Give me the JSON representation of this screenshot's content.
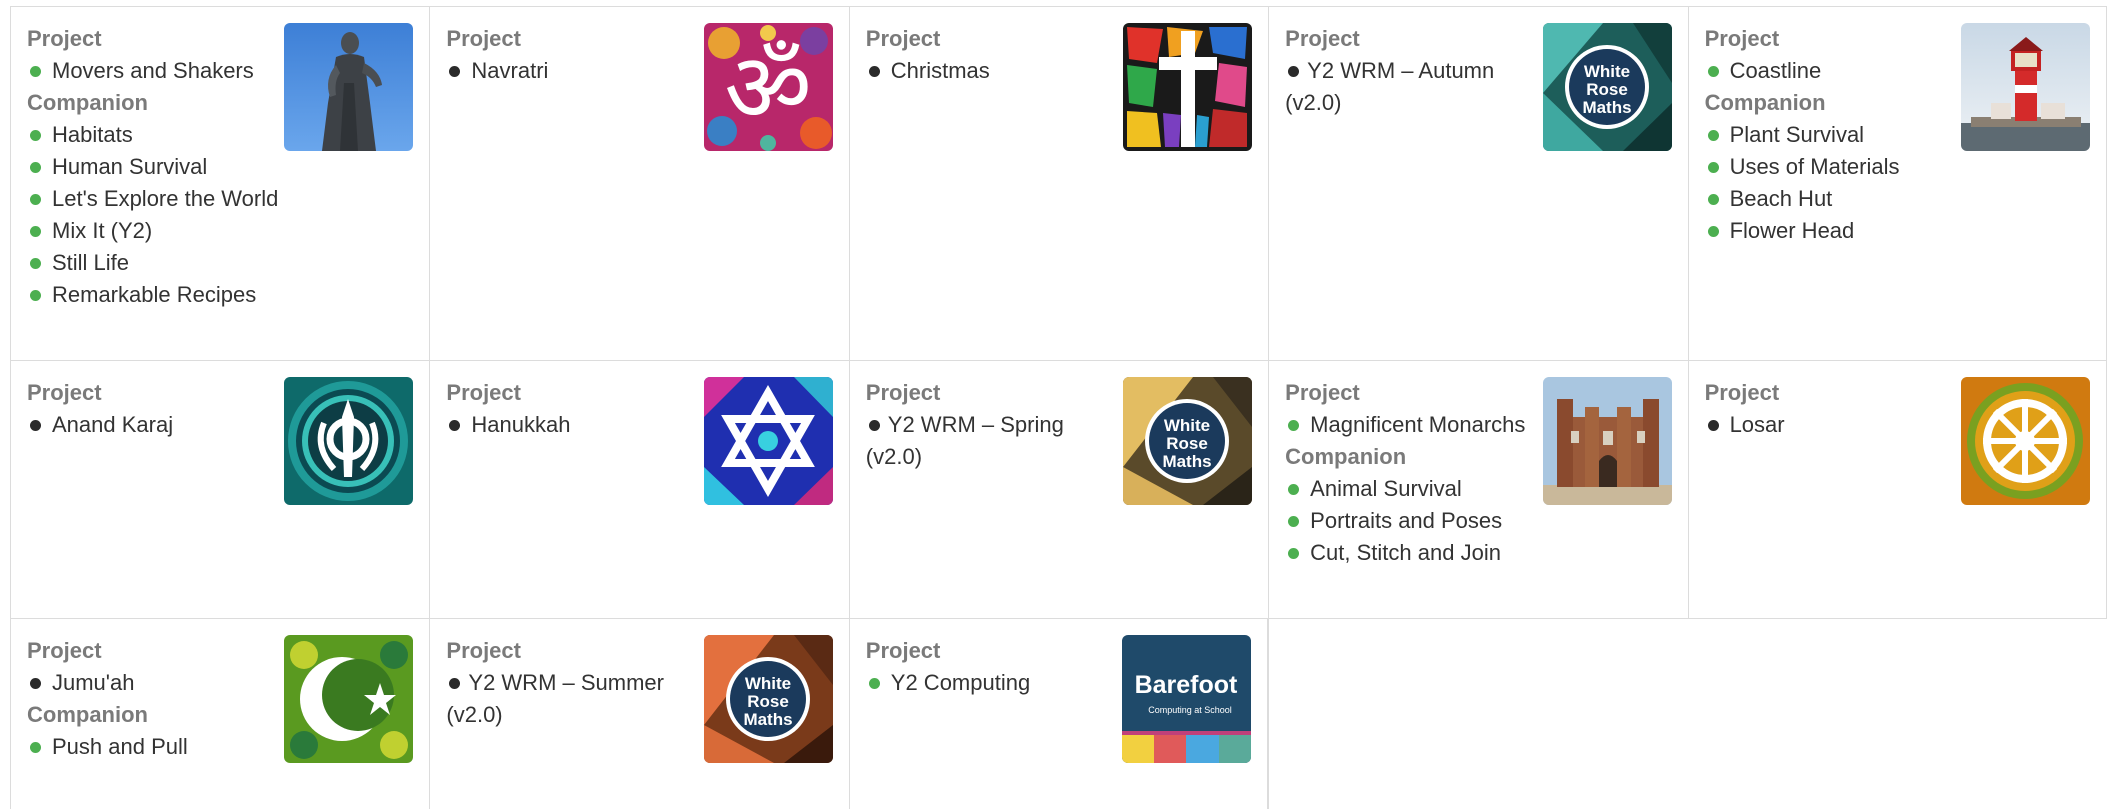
{
  "cells": [
    {
      "heading": "Project",
      "project_items": [
        {
          "label": "Movers and Shakers",
          "dot": "green"
        }
      ],
      "companion_heading": "Companion",
      "companion_items": [
        {
          "label": "Habitats",
          "dot": "green"
        },
        {
          "label": "Human Survival",
          "dot": "green"
        },
        {
          "label": "Let's Explore the World",
          "dot": "green"
        },
        {
          "label": "Mix It (Y2)",
          "dot": "green"
        },
        {
          "label": "Still Life",
          "dot": "green"
        },
        {
          "label": "Remarkable Recipes",
          "dot": "green"
        }
      ],
      "image": "statue-photo"
    },
    {
      "heading": "Project",
      "project_items": [
        {
          "label": "Navratri",
          "dot": "black"
        }
      ],
      "image": "om-symbol"
    },
    {
      "heading": "Project",
      "project_items": [
        {
          "label": "Christmas",
          "dot": "black"
        }
      ],
      "image": "stained-glass-cross"
    },
    {
      "heading": "Project",
      "project_items": [
        {
          "label": "Y2 WRM – Autumn (v2.0)",
          "dot": "black"
        }
      ],
      "image": "white-rose-maths-teal",
      "logo_text": [
        "White",
        "Rose",
        "Maths"
      ]
    },
    {
      "heading": "Project",
      "project_items": [
        {
          "label": "Coastline",
          "dot": "green"
        }
      ],
      "companion_heading": "Companion",
      "companion_items": [
        {
          "label": "Plant Survival",
          "dot": "green"
        },
        {
          "label": "Uses of Materials",
          "dot": "green"
        },
        {
          "label": "Beach Hut",
          "dot": "green"
        },
        {
          "label": "Flower Head",
          "dot": "green"
        }
      ],
      "image": "lighthouse-photo"
    },
    {
      "heading": "Project",
      "project_items": [
        {
          "label": "Anand Karaj",
          "dot": "black"
        }
      ],
      "image": "khanda-symbol"
    },
    {
      "heading": "Project",
      "project_items": [
        {
          "label": "Hanukkah",
          "dot": "black"
        }
      ],
      "image": "star-of-david"
    },
    {
      "heading": "Project",
      "project_items": [
        {
          "label": "Y2 WRM – Spring (v2.0)",
          "dot": "black"
        }
      ],
      "image": "white-rose-maths-gold",
      "logo_text": [
        "White",
        "Rose",
        "Maths"
      ]
    },
    {
      "heading": "Project",
      "project_items": [
        {
          "label": "Magnificent Monarchs",
          "dot": "green"
        }
      ],
      "companion_heading": "Companion",
      "companion_items": [
        {
          "label": "Animal Survival",
          "dot": "green"
        },
        {
          "label": "Portraits and Poses",
          "dot": "green"
        },
        {
          "label": "Cut, Stitch and Join",
          "dot": "green"
        }
      ],
      "image": "palace-photo"
    },
    {
      "heading": "Project",
      "project_items": [
        {
          "label": "Losar",
          "dot": "black"
        }
      ],
      "image": "dharma-wheel"
    },
    {
      "heading": "Project",
      "project_items": [
        {
          "label": "Jumu'ah",
          "dot": "black"
        }
      ],
      "companion_heading": "Companion",
      "companion_items": [
        {
          "label": "Push and Pull",
          "dot": "green"
        }
      ],
      "image": "crescent-star"
    },
    {
      "heading": "Project",
      "project_items": [
        {
          "label": "Y2 WRM – Summer (v2.0)",
          "dot": "black"
        }
      ],
      "image": "white-rose-maths-orange",
      "logo_text": [
        "White",
        "Rose",
        "Maths"
      ]
    },
    {
      "heading": "Project",
      "project_items": [
        {
          "label": "Y2 Computing",
          "dot": "green"
        }
      ],
      "image": "barefoot-logo",
      "logo_text": [
        "Barefoot",
        "Computing at School"
      ]
    }
  ],
  "colors": {
    "green_dot": "#4caf50",
    "black_dot": "#2a2a2a",
    "heading": "#7a7a7a",
    "border": "#dcdcdc"
  }
}
